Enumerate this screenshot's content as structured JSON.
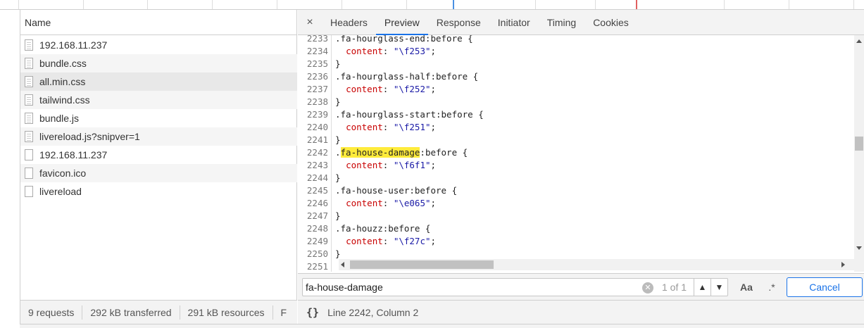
{
  "left_panel": {
    "column_header": "Name",
    "requests": [
      {
        "name": "192.168.11.237",
        "icon": "document-icon"
      },
      {
        "name": "bundle.css",
        "icon": "stylesheet-icon"
      },
      {
        "name": "all.min.css",
        "icon": "stylesheet-icon"
      },
      {
        "name": "tailwind.css",
        "icon": "stylesheet-icon"
      },
      {
        "name": "bundle.js",
        "icon": "script-icon"
      },
      {
        "name": "livereload.js?snipver=1",
        "icon": "script-icon"
      },
      {
        "name": "192.168.11.237",
        "icon": "document-icon"
      },
      {
        "name": "favicon.ico",
        "icon": "file-icon"
      },
      {
        "name": "livereload",
        "icon": "file-icon"
      }
    ],
    "status": {
      "requests": "9 requests",
      "transferred": "292 kB transferred",
      "resources": "291 kB resources",
      "finish": "F"
    }
  },
  "tabs": {
    "close": "×",
    "items": [
      "Headers",
      "Preview",
      "Response",
      "Initiator",
      "Timing",
      "Cookies"
    ],
    "active": "Preview"
  },
  "code": {
    "lines": [
      {
        "n": "2233",
        "sel": ".fa-hourglass-end:before {",
        "kind": "selector"
      },
      {
        "n": "2234",
        "prop": "content",
        "val": "\"\\f253\"",
        "kind": "decl"
      },
      {
        "n": "2235",
        "sel": "}",
        "kind": "close"
      },
      {
        "n": "2236",
        "sel": ".fa-hourglass-half:before {",
        "kind": "selector"
      },
      {
        "n": "2237",
        "prop": "content",
        "val": "\"\\f252\"",
        "kind": "decl"
      },
      {
        "n": "2238",
        "sel": "}",
        "kind": "close"
      },
      {
        "n": "2239",
        "sel": ".fa-hourglass-start:before {",
        "kind": "selector"
      },
      {
        "n": "2240",
        "prop": "content",
        "val": "\"\\f251\"",
        "kind": "decl"
      },
      {
        "n": "2241",
        "sel": "}",
        "kind": "close"
      },
      {
        "n": "2242",
        "pre": ".",
        "hl": "fa-house-damage",
        "post": ":before {",
        "kind": "highlight"
      },
      {
        "n": "2243",
        "prop": "content",
        "val": "\"\\f6f1\"",
        "kind": "decl"
      },
      {
        "n": "2244",
        "sel": "}",
        "kind": "close"
      },
      {
        "n": "2245",
        "sel": ".fa-house-user:before {",
        "kind": "selector"
      },
      {
        "n": "2246",
        "prop": "content",
        "val": "\"\\e065\"",
        "kind": "decl"
      },
      {
        "n": "2247",
        "sel": "}",
        "kind": "close"
      },
      {
        "n": "2248",
        "sel": ".fa-houzz:before {",
        "kind": "selector"
      },
      {
        "n": "2249",
        "prop": "content",
        "val": "\"\\f27c\"",
        "kind": "decl"
      },
      {
        "n": "2250",
        "sel": "}",
        "kind": "close"
      },
      {
        "n": "2251",
        "sel": "",
        "kind": "close"
      }
    ]
  },
  "search": {
    "value": "fa-house-damage",
    "match_count": "1 of 1",
    "case_label": "Aa",
    "regex_label": ".*",
    "cancel_label": "Cancel"
  },
  "footer": {
    "pretty_print": "{}",
    "cursor_position": "Line 2242, Column 2"
  },
  "colors": {
    "accent": "#1a73e8",
    "highlight": "#ffeb3b",
    "property": "#c80000",
    "string": "#1a1aa6"
  }
}
